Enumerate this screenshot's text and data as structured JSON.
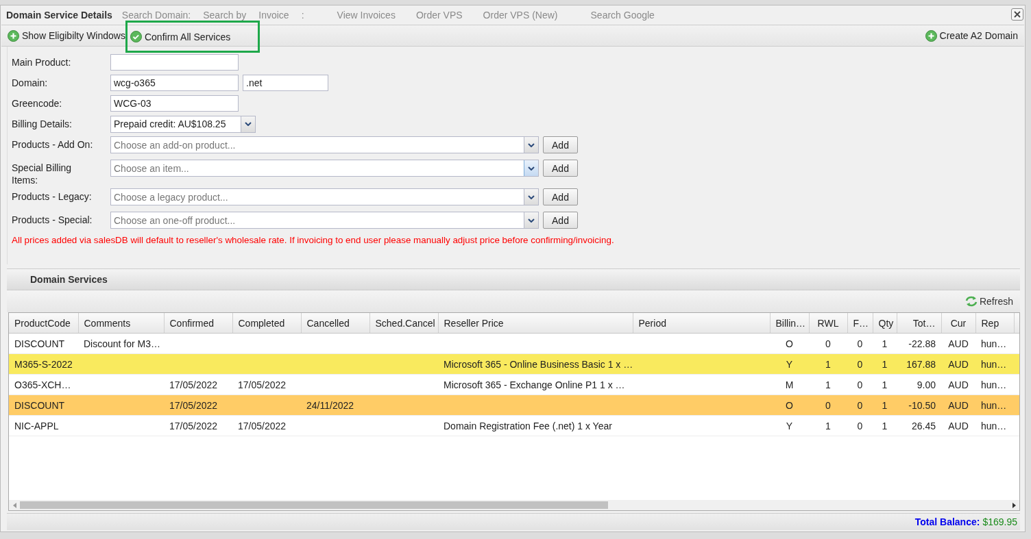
{
  "window": {
    "title": "Domain Service Details"
  },
  "background_toolbar": [
    "Search Domain:",
    "Search by",
    "Invoice",
    ":",
    "View Invoices",
    "Order VPS",
    "Order VPS (New)",
    "Search Google"
  ],
  "toolbar": {
    "left": [
      {
        "label": "Show Eligibilty Windows",
        "kind": "add",
        "highlighted": false
      },
      {
        "label": "Confirm All Services",
        "kind": "confirm",
        "highlighted": true
      }
    ],
    "right": [
      {
        "label": "Create A2 Domain",
        "kind": "add",
        "highlighted": false
      }
    ]
  },
  "form": {
    "main_product": {
      "label": "Main Product:"
    },
    "domain": {
      "label": "Domain:",
      "value": "wcg-o365",
      "tld": ".net"
    },
    "greencode": {
      "label": "Greencode:",
      "value": "WCG-03"
    },
    "billing": {
      "label": "Billing Details:",
      "value": "Prepaid credit: AU$108.25"
    },
    "product_pickers": [
      {
        "label": "Products - Add On:",
        "placeholder": "Choose an add-on product...",
        "button": "Add",
        "focused": false
      },
      {
        "label": "Special Billing Items:",
        "placeholder": "Choose an item...",
        "button": "Add",
        "focused": true
      },
      {
        "label": "Products - Legacy:",
        "placeholder": "Choose a legacy product...",
        "button": "Add",
        "focused": false
      },
      {
        "label": "Products - Special:",
        "placeholder": "Choose an one-off product...",
        "button": "Add",
        "focused": false
      }
    ],
    "warning": "All prices added via salesDB will default to reseller's wholesale rate. If invoicing to end user please manually adjust price before confirming/invoicing."
  },
  "services": {
    "title": "Domain Services",
    "refresh": "Refresh",
    "columns": [
      "ProductCode",
      "Comments",
      "Confirmed",
      "Completed",
      "Cancelled",
      "Sched.Cancel",
      "Reseller Price",
      "Period",
      "Billin…",
      "RWL",
      "F…",
      "Qty",
      "Tot…",
      "Cur",
      "Rep"
    ],
    "rows": [
      {
        "color": "#ffffff",
        "cells": [
          "DISCOUNT",
          "Discount for M3…",
          "",
          "",
          "",
          "",
          "",
          "",
          "O",
          "0",
          "0",
          "1",
          "-22.88",
          "AUD",
          "hun…"
        ]
      },
      {
        "color": "#f9ea5e",
        "cells": [
          "M365-S-2022",
          "",
          "",
          "",
          "",
          "",
          "Microsoft 365 - Online Business Basic 1 x …",
          "",
          "Y",
          "1",
          "0",
          "1",
          "167.88",
          "AUD",
          "hun…"
        ]
      },
      {
        "color": "#ffffff",
        "cells": [
          "O365-XCH…",
          "",
          "17/05/2022",
          "17/05/2022",
          "",
          "",
          "Microsoft 365 - Exchange Online P1 1 x …",
          "",
          "M",
          "1",
          "0",
          "1",
          "9.00",
          "AUD",
          "hun…"
        ]
      },
      {
        "color": "#ffcc66",
        "cells": [
          "DISCOUNT",
          "",
          "17/05/2022",
          "",
          "24/11/2022",
          "",
          "",
          "",
          "O",
          "0",
          "0",
          "1",
          "-10.50",
          "AUD",
          "hun…"
        ]
      },
      {
        "color": "#ffffff",
        "cells": [
          "NIC-APPL",
          "",
          "17/05/2022",
          "17/05/2022",
          "",
          "",
          "Domain Registration Fee (.net) 1 x Year",
          "",
          "Y",
          "1",
          "0",
          "1",
          "26.45",
          "AUD",
          "hun…"
        ]
      }
    ],
    "total_label": "Total Balance:",
    "total_value": "$169.95"
  }
}
